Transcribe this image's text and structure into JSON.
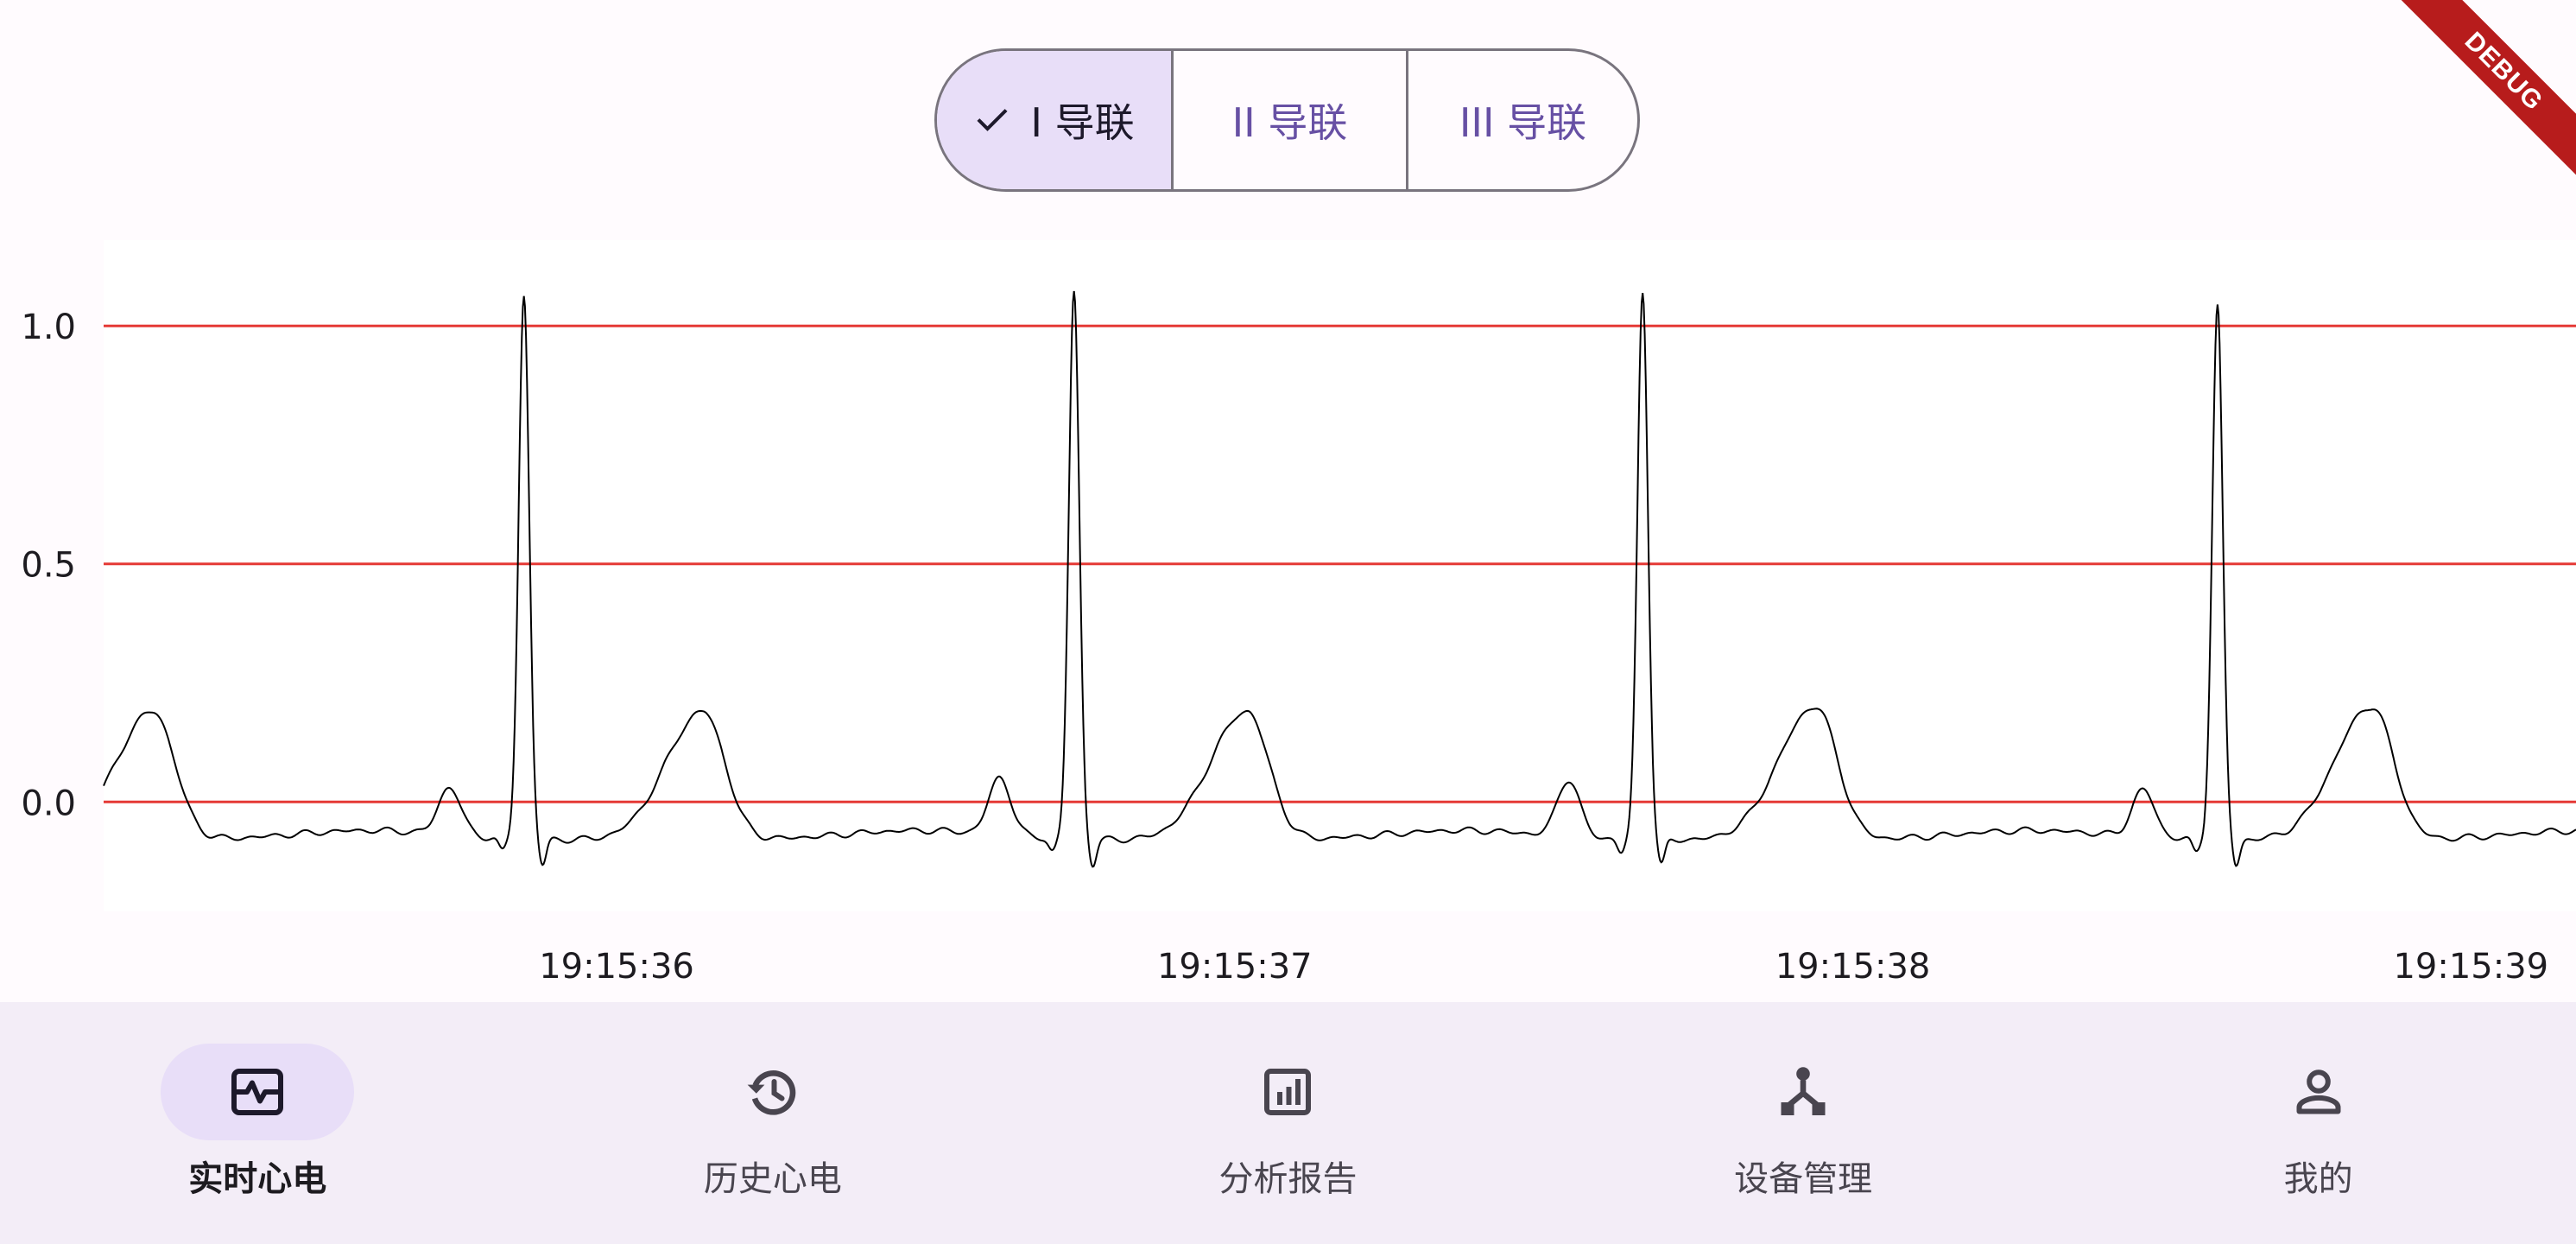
{
  "lead_selector": {
    "segments": [
      {
        "label": "I 导联",
        "selected": true
      },
      {
        "label": "II 导联",
        "selected": false
      },
      {
        "label": "III 导联",
        "selected": false
      }
    ]
  },
  "debug_banner": {
    "label": "DEBUG"
  },
  "colors": {
    "accent": "#6750A4",
    "selected_container": "#E8DEF8",
    "gridline": "#E53935",
    "waveform": "#000000",
    "nav_background": "#F3EDF7"
  },
  "chart_data": {
    "type": "line",
    "y_ticks": [
      "1.0",
      "0.5",
      "0.0"
    ],
    "y_tick_values": [
      1.0,
      0.5,
      0.0
    ],
    "ylim": [
      -0.23,
      1.18
    ],
    "x_ticks": [
      "19:15:36",
      "19:15:37",
      "19:15:38",
      "19:15:39"
    ],
    "x_tick_values": [
      0.83,
      1.83,
      2.83,
      3.83
    ],
    "xlim": [
      0.0,
      4.0
    ],
    "grid": "horizontal lines at y ticks",
    "series": [
      {
        "beats_t_wave_peak_time": [
          0.08,
          0.97,
          1.85,
          2.77,
          3.67
        ],
        "beats_r_peak_time": [
          0.68,
          1.57,
          2.49,
          3.42
        ],
        "r_peak_amplitude": [
          1.06,
          1.07,
          1.07,
          1.04
        ],
        "t_wave_amplitude": [
          0.19,
          0.19,
          0.19,
          0.2,
          0.2
        ],
        "p_wave_amplitude": [
          0.02,
          0.04,
          0.04,
          0.02
        ],
        "baseline": -0.08,
        "s_trough": -0.13
      }
    ]
  },
  "bottom_nav": {
    "items": [
      {
        "label": "实时心电",
        "icon": "ecg-monitor-icon",
        "active": true
      },
      {
        "label": "历史心电",
        "icon": "history-icon",
        "active": false
      },
      {
        "label": "分析报告",
        "icon": "analytics-report-icon",
        "active": false
      },
      {
        "label": "设备管理",
        "icon": "device-hub-icon",
        "active": false
      },
      {
        "label": "我的",
        "icon": "person-icon",
        "active": false
      }
    ]
  }
}
